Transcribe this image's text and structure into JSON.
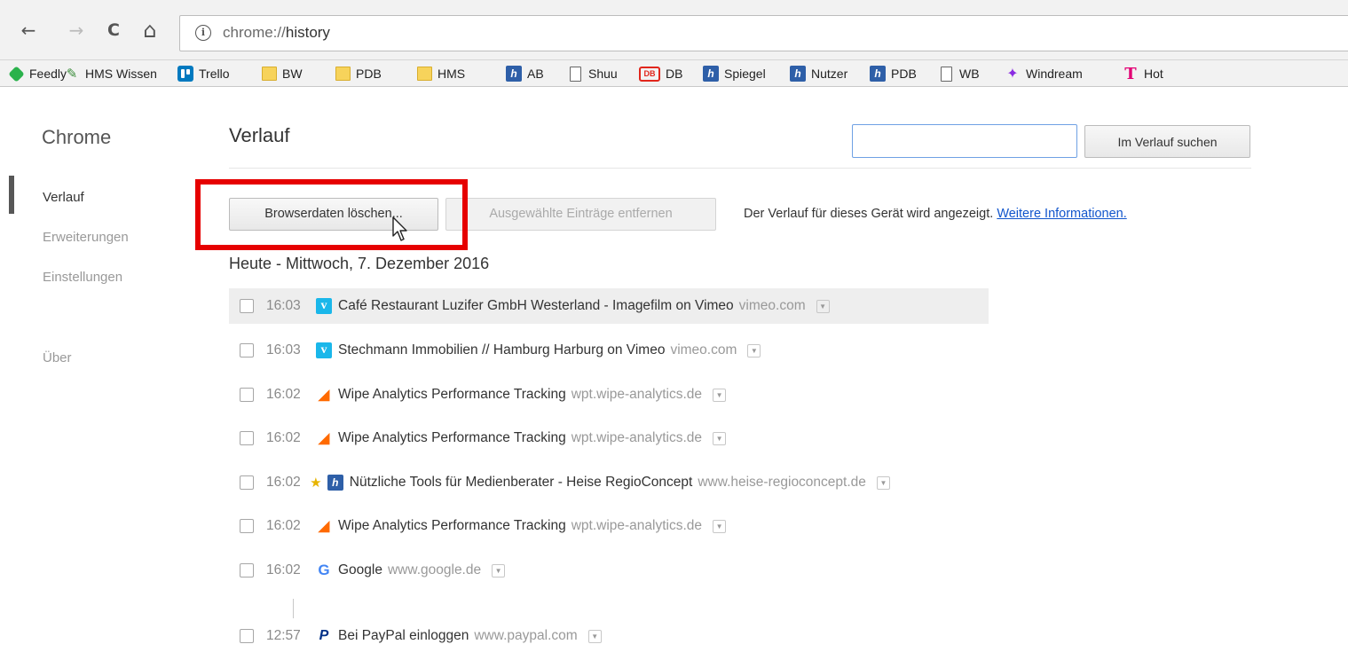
{
  "browser": {
    "back_glyph": "←",
    "forward_glyph": "→",
    "reload_glyph": "C",
    "home_glyph": "⌂",
    "info_glyph": "i",
    "url_scheme": "chrome://",
    "url_path": "history"
  },
  "bookmarks": [
    {
      "label": "Feedly",
      "icon": "feedly-icon"
    },
    {
      "label": "HMS Wissen",
      "icon": "hms-icon"
    },
    {
      "label": "Trello",
      "icon": "trello-icon"
    },
    {
      "label": "BW",
      "icon": "folder-icon"
    },
    {
      "label": "PDB",
      "icon": "folder-icon"
    },
    {
      "label": "HMS",
      "icon": "folder-icon"
    },
    {
      "label": "AB",
      "icon": "heise-icon"
    },
    {
      "label": "Shuu",
      "icon": "page-icon"
    },
    {
      "label": "DB",
      "icon": "db-icon",
      "icon_text": "DB"
    },
    {
      "label": "Spiegel",
      "icon": "heise-icon"
    },
    {
      "label": "Nutzer",
      "icon": "heise-icon"
    },
    {
      "label": "PDB",
      "icon": "heise-icon"
    },
    {
      "label": "WB",
      "icon": "page-icon"
    },
    {
      "label": "Windream",
      "icon": "windream-icon"
    },
    {
      "label": "Hot",
      "icon": "telekom-icon",
      "icon_text": "T"
    }
  ],
  "sidebar": {
    "title": "Chrome",
    "items": [
      {
        "label": "Verlauf",
        "active": true
      },
      {
        "label": "Erweiterungen",
        "active": false
      },
      {
        "label": "Einstellungen",
        "active": false
      },
      {
        "label": "Über",
        "active": false
      }
    ]
  },
  "main": {
    "title": "Verlauf",
    "search_value": "",
    "search_button": "Im Verlauf suchen",
    "clear_button": "Browserdaten löschen...",
    "remove_button": "Ausgewählte Einträge entfernen",
    "info_text": "Der Verlauf für dieses Gerät wird angezeigt.",
    "info_link": "Weitere Informationen.",
    "date_heading": "Heute - Mittwoch, 7. Dezember 2016"
  },
  "history": [
    {
      "time": "16:03",
      "icon": "vimeo-icon",
      "glyph": "v",
      "title": "Café Restaurant Luzifer GmbH Westerland - Imagefilm on Vimeo",
      "domain": "vimeo.com",
      "starred": false
    },
    {
      "time": "16:03",
      "icon": "vimeo-icon",
      "glyph": "v",
      "title": "Stechmann Immobilien // Hamburg Harburg on Vimeo",
      "domain": "vimeo.com",
      "starred": false
    },
    {
      "time": "16:02",
      "icon": "wipe-analytics-icon",
      "glyph": "◢",
      "title": "Wipe Analytics Performance Tracking",
      "domain": "wpt.wipe-analytics.de",
      "starred": false
    },
    {
      "time": "16:02",
      "icon": "wipe-analytics-icon",
      "glyph": "◢",
      "title": "Wipe Analytics Performance Tracking",
      "domain": "wpt.wipe-analytics.de",
      "starred": false
    },
    {
      "time": "16:02",
      "icon": "heise-icon",
      "glyph": "h",
      "title": "Nützliche Tools für Medienberater - Heise RegioConcept",
      "domain": "www.heise-regioconcept.de",
      "starred": true
    },
    {
      "time": "16:02",
      "icon": "wipe-analytics-icon",
      "glyph": "◢",
      "title": "Wipe Analytics Performance Tracking",
      "domain": "wpt.wipe-analytics.de",
      "starred": false
    },
    {
      "time": "16:02",
      "icon": "google-icon",
      "glyph": "G",
      "title": "Google",
      "domain": "www.google.de",
      "starred": false
    },
    {
      "time": "12:57",
      "icon": "paypal-icon",
      "glyph": "P",
      "title": "Bei PayPal einloggen",
      "domain": "www.paypal.com",
      "starred": false
    }
  ],
  "glyphs": {
    "star": "★",
    "menu": "▼"
  }
}
